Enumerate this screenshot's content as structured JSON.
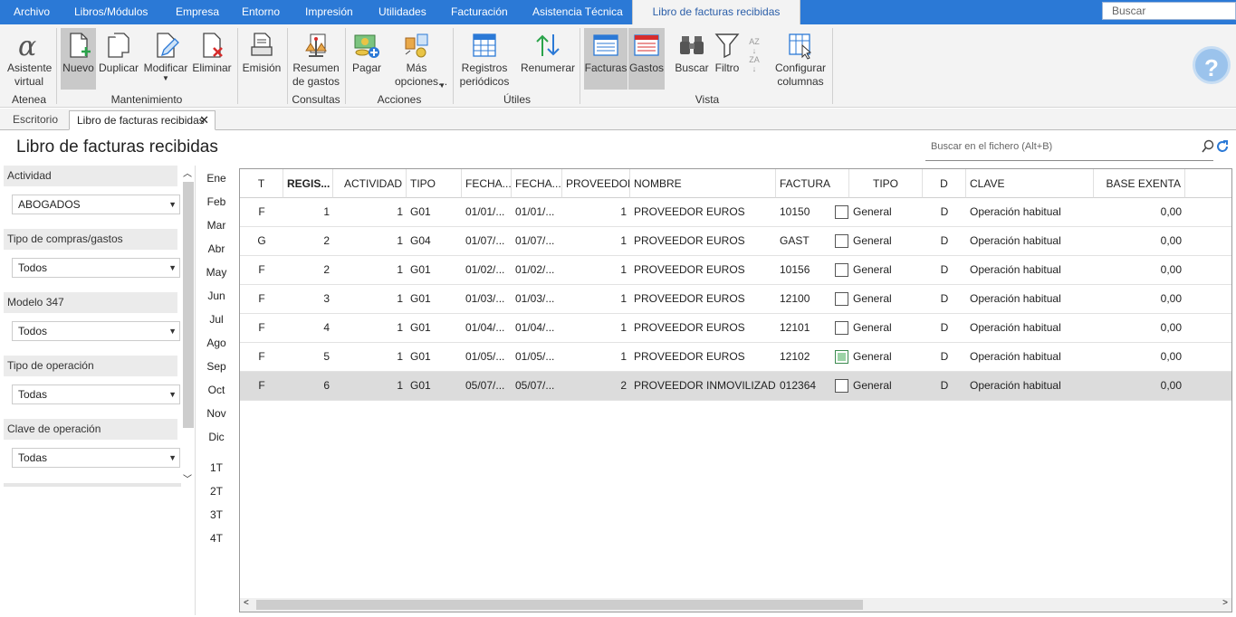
{
  "menubar": {
    "items": [
      "Archivo",
      "Libros/Módulos",
      "Empresa",
      "Entorno",
      "Impresión",
      "Utilidades",
      "Facturación",
      "Asistencia Técnica",
      "Libro de facturas recibidas"
    ],
    "search_placeholder": "Buscar"
  },
  "ribbon": {
    "buttons": {
      "asistente": "Asistente virtual",
      "nuevo": "Nuevo",
      "duplicar": "Duplicar",
      "modificar": "Modificar",
      "eliminar": "Eliminar",
      "emision": "Emisión",
      "resumen": "Resumen de gastos",
      "pagar": "Pagar",
      "mas": "Más opciones...",
      "registros": "Registros periódicos",
      "renumerar": "Renumerar",
      "facturas": "Facturas",
      "gastos": "Gastos",
      "buscar": "Buscar",
      "filtro": "Filtro",
      "configurar": "Configurar columnas"
    },
    "groups": {
      "atenea": "Atenea",
      "mantenimiento": "Mantenimiento",
      "consultas": "Consultas",
      "acciones": "Acciones",
      "utiles": "Útiles",
      "vista": "Vista"
    },
    "sort_az": "AZ",
    "sort_za": "ZA"
  },
  "tabs": [
    "Escritorio",
    "Libro de facturas recibidas"
  ],
  "page": {
    "title": "Libro de facturas recibidas",
    "file_search_placeholder": "Buscar en el fichero (Alt+B)"
  },
  "filters": [
    {
      "label": "Actividad",
      "value": "ABOGADOS"
    },
    {
      "label": "Tipo de compras/gastos",
      "value": "Todos"
    },
    {
      "label": "Modelo 347",
      "value": "Todos"
    },
    {
      "label": "Tipo de operación",
      "value": "Todas"
    },
    {
      "label": "Clave de operación",
      "value": "Todas"
    }
  ],
  "months": [
    "Ene",
    "Feb",
    "Mar",
    "Abr",
    "May",
    "Jun",
    "Jul",
    "Ago",
    "Sep",
    "Oct",
    "Nov",
    "Dic"
  ],
  "quarters": [
    "1T",
    "2T",
    "3T",
    "4T"
  ],
  "grid": {
    "headers": [
      "T",
      "REGIS...",
      "ACTIVIDAD",
      "TIPO",
      "FECHA...",
      "FECHA...",
      "PROVEEDOR",
      "NOMBRE",
      "FACTURA",
      "TIPO",
      "D",
      "CLAVE",
      "BASE EXENTA"
    ],
    "rows": [
      {
        "t": "F",
        "reg": "1",
        "act": "1",
        "tipo": "G01",
        "f1": "01/01/...",
        "f2": "01/01/...",
        "prov": "1",
        "nombre": "PROVEEDOR EUROS",
        "factura": "10150",
        "checked": false,
        "tipo2": "General",
        "d": "D",
        "clave": "Operación habitual",
        "base": "0,00"
      },
      {
        "t": "G",
        "reg": "2",
        "act": "1",
        "tipo": "G04",
        "f1": "01/07/...",
        "f2": "01/07/...",
        "prov": "1",
        "nombre": "PROVEEDOR EUROS",
        "factura": "GAST",
        "checked": false,
        "tipo2": "General",
        "d": "D",
        "clave": "Operación habitual",
        "base": "0,00"
      },
      {
        "t": "F",
        "reg": "2",
        "act": "1",
        "tipo": "G01",
        "f1": "01/02/...",
        "f2": "01/02/...",
        "prov": "1",
        "nombre": "PROVEEDOR EUROS",
        "factura": "10156",
        "checked": false,
        "tipo2": "General",
        "d": "D",
        "clave": "Operación habitual",
        "base": "0,00"
      },
      {
        "t": "F",
        "reg": "3",
        "act": "1",
        "tipo": "G01",
        "f1": "01/03/...",
        "f2": "01/03/...",
        "prov": "1",
        "nombre": "PROVEEDOR EUROS",
        "factura": "12100",
        "checked": false,
        "tipo2": "General",
        "d": "D",
        "clave": "Operación habitual",
        "base": "0,00"
      },
      {
        "t": "F",
        "reg": "4",
        "act": "1",
        "tipo": "G01",
        "f1": "01/04/...",
        "f2": "01/04/...",
        "prov": "1",
        "nombre": "PROVEEDOR EUROS",
        "factura": "12101",
        "checked": false,
        "tipo2": "General",
        "d": "D",
        "clave": "Operación habitual",
        "base": "0,00"
      },
      {
        "t": "F",
        "reg": "5",
        "act": "1",
        "tipo": "G01",
        "f1": "01/05/...",
        "f2": "01/05/...",
        "prov": "1",
        "nombre": "PROVEEDOR EUROS",
        "factura": "12102",
        "checked": true,
        "tipo2": "General",
        "d": "D",
        "clave": "Operación habitual",
        "base": "0,00"
      },
      {
        "t": "F",
        "reg": "6",
        "act": "1",
        "tipo": "G01",
        "f1": "05/07/...",
        "f2": "05/07/...",
        "prov": "2",
        "nombre": "PROVEEDOR INMOVILIZADO",
        "factura": "012364",
        "checked": false,
        "tipo2": "General",
        "d": "D",
        "clave": "Operación habitual",
        "base": "0,00",
        "selected": true
      }
    ]
  },
  "colors": {
    "accent": "#2b79d6",
    "ribbon_bg": "#f3f3f3",
    "selected_row": "#dcdcdc"
  }
}
